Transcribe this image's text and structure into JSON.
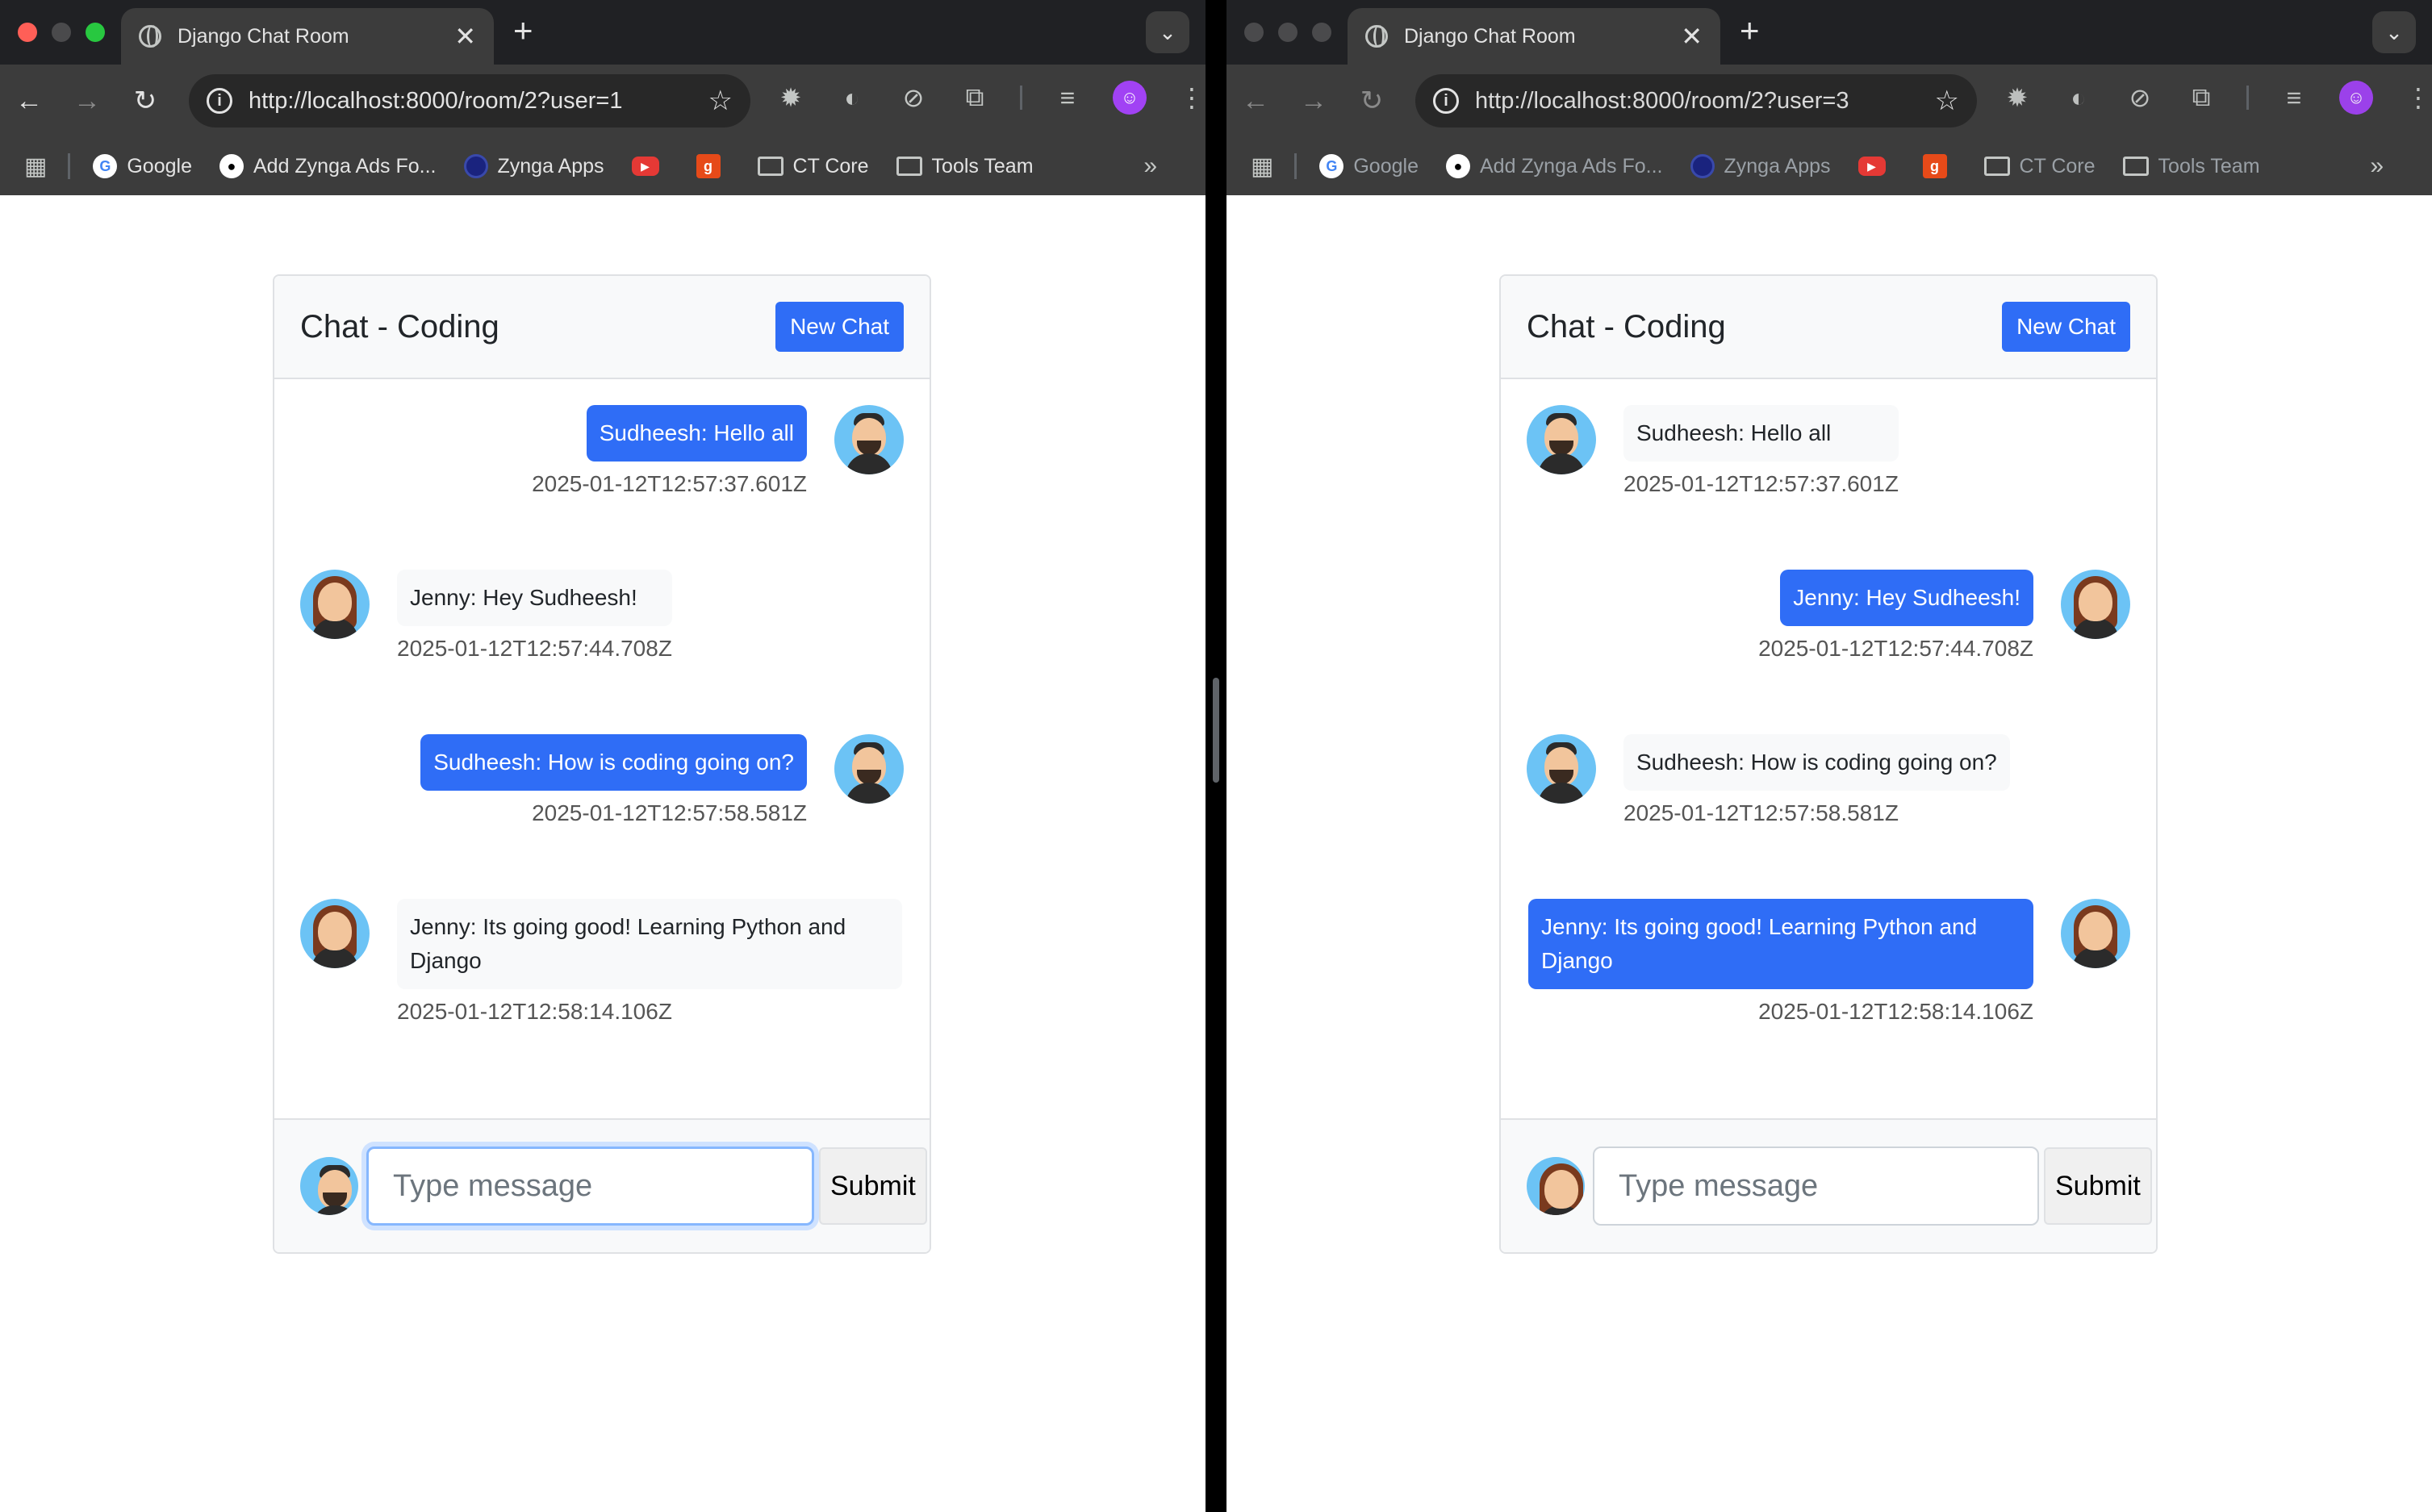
{
  "windows": [
    {
      "tab": {
        "title": "Django Chat Room",
        "close": "✕",
        "new_tab": "+"
      },
      "url": "http://localhost:8000/room/2?user=1",
      "bookmarks": [
        "Google",
        "Add Zynga Ads Fo...",
        "Zynga Apps",
        "",
        "",
        "CT Core",
        "Tools Team"
      ],
      "chat": {
        "title": "Chat - Coding",
        "new_chat_label": "New Chat",
        "messages": [
          {
            "text": "Sudheesh: Hello all",
            "timestamp": "2025-01-12T12:57:37.601Z",
            "sender": "Sudheesh",
            "side": "right"
          },
          {
            "text": "Jenny: Hey Sudheesh!",
            "timestamp": "2025-01-12T12:57:44.708Z",
            "sender": "Jenny",
            "side": "left"
          },
          {
            "text": "Sudheesh: How is coding going on?",
            "timestamp": "2025-01-12T12:57:58.581Z",
            "sender": "Sudheesh",
            "side": "right"
          },
          {
            "text": "Jenny: Its going good! Learning Python and Django",
            "timestamp": "2025-01-12T12:58:14.106Z",
            "sender": "Jenny",
            "side": "left"
          }
        ],
        "input_placeholder": "Type message",
        "submit_label": "Submit",
        "current_user": "Sudheesh"
      }
    },
    {
      "tab": {
        "title": "Django Chat Room",
        "close": "✕",
        "new_tab": "+"
      },
      "url": "http://localhost:8000/room/2?user=3",
      "bookmarks": [
        "Google",
        "Add Zynga Ads Fo...",
        "Zynga Apps",
        "",
        "",
        "CT Core",
        "Tools Team"
      ],
      "chat": {
        "title": "Chat - Coding",
        "new_chat_label": "New Chat",
        "messages": [
          {
            "text": "Sudheesh: Hello all",
            "timestamp": "2025-01-12T12:57:37.601Z",
            "sender": "Sudheesh",
            "side": "left"
          },
          {
            "text": "Jenny: Hey Sudheesh!",
            "timestamp": "2025-01-12T12:57:44.708Z",
            "sender": "Jenny",
            "side": "right"
          },
          {
            "text": "Sudheesh: How is coding going on?",
            "timestamp": "2025-01-12T12:57:58.581Z",
            "sender": "Sudheesh",
            "side": "left"
          },
          {
            "text": "Jenny: Its going good! Learning Python and Django",
            "timestamp": "2025-01-12T12:58:14.106Z",
            "sender": "Jenny",
            "side": "right"
          }
        ],
        "input_placeholder": "Type message",
        "submit_label": "Submit",
        "current_user": "Jenny"
      }
    }
  ],
  "colors": {
    "primary": "#2f6df6",
    "other_bubble": "#f8f9fa",
    "chrome_dark": "#202124",
    "chrome_toolbar": "#3c3c3c"
  },
  "icons": {
    "back": "←",
    "forward": "→",
    "reload": "↻",
    "star": "☆",
    "menu": "⋮",
    "apps": "▦",
    "more": "»",
    "chevron": "⌄"
  }
}
